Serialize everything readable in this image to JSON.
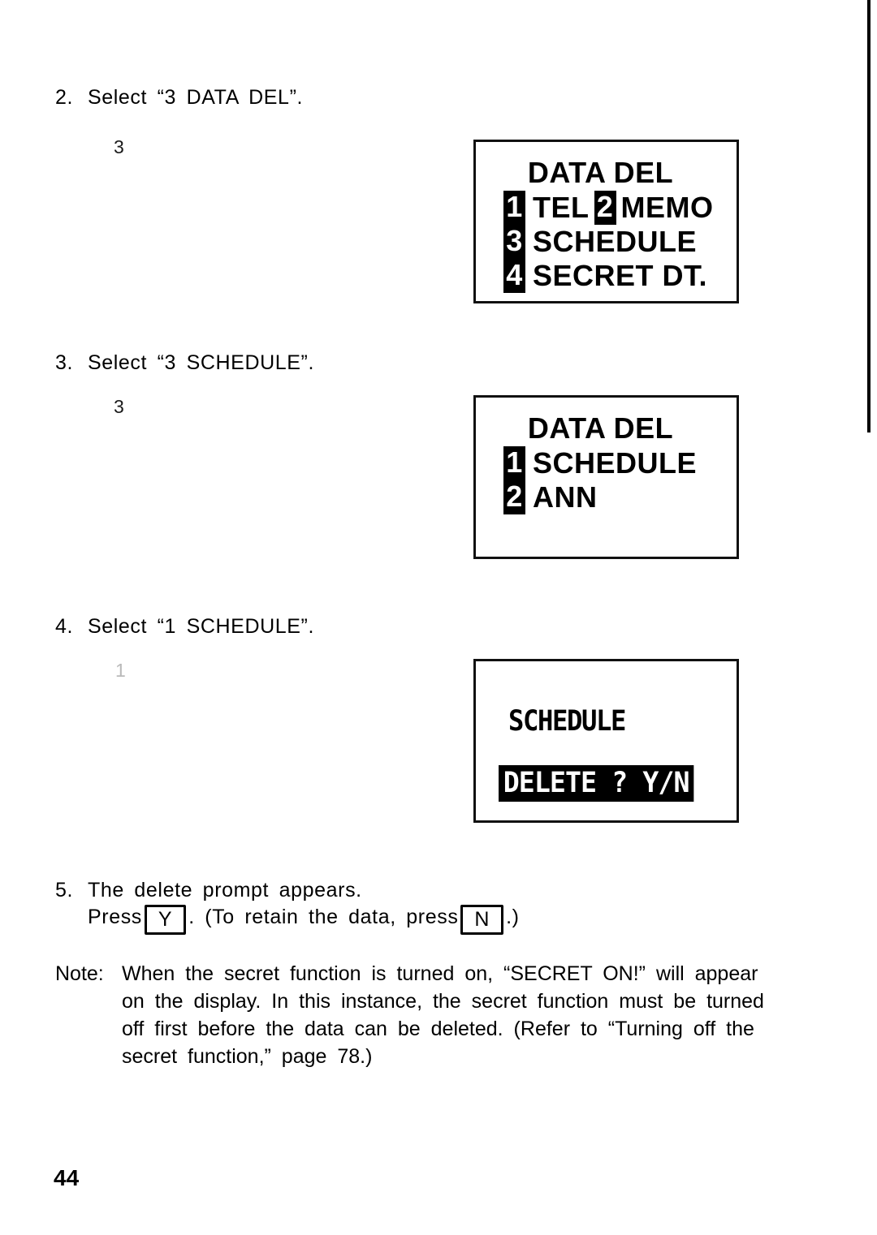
{
  "page": {
    "number": "44"
  },
  "steps": [
    {
      "number": "2.",
      "text": "Select  “3  DATA  DEL”.",
      "keymark": "3"
    },
    {
      "number": "3.",
      "text": "Select  “3  SCHEDULE”.",
      "keymark": "3"
    },
    {
      "number": "4.",
      "text": "Select  “1  SCHEDULE”.",
      "keymark": "1"
    },
    {
      "number": "5.",
      "text": "The  delete  prompt  appears."
    }
  ],
  "step5": {
    "press_label": "Press",
    "key_yes": "Y",
    "after_yes": ".  (To  retain  the  data,  press",
    "key_no": "N",
    "after_no": ".)"
  },
  "displays": [
    {
      "name": "data-del-menu",
      "title": "DATA DEL",
      "rows": [
        {
          "badge": "1",
          "text": "TEL",
          "inline_badge": "2",
          "text2": "MEMO"
        },
        {
          "badge": "3",
          "text": "SCHEDULE"
        },
        {
          "badge": "4",
          "text": "SECRET DT."
        }
      ]
    },
    {
      "name": "schedule-ann-menu",
      "title": "DATA DEL",
      "rows": [
        {
          "badge": "1",
          "text": "SCHEDULE"
        },
        {
          "badge": "2",
          "text": "ANN"
        }
      ]
    },
    {
      "name": "delete-prompt",
      "line1": "SCHEDULE",
      "line2": "DELETE ? Y/N"
    }
  ],
  "note": {
    "label": "Note:",
    "lines": [
      "When  the  secret  function  is  turned  on,  “SECRET ON!”  will  appear",
      "on  the  display.  In  this  instance,  the  secret  function  must  be  turned",
      "off  first  before  the  data  can  be  deleted.  (Refer  to  “Turning  off  the",
      "secret  function,”  page  78.)"
    ]
  },
  "colors": {
    "ink": "#000000",
    "paper": "#ffffff",
    "faint_ink": "#b9b9b9"
  }
}
